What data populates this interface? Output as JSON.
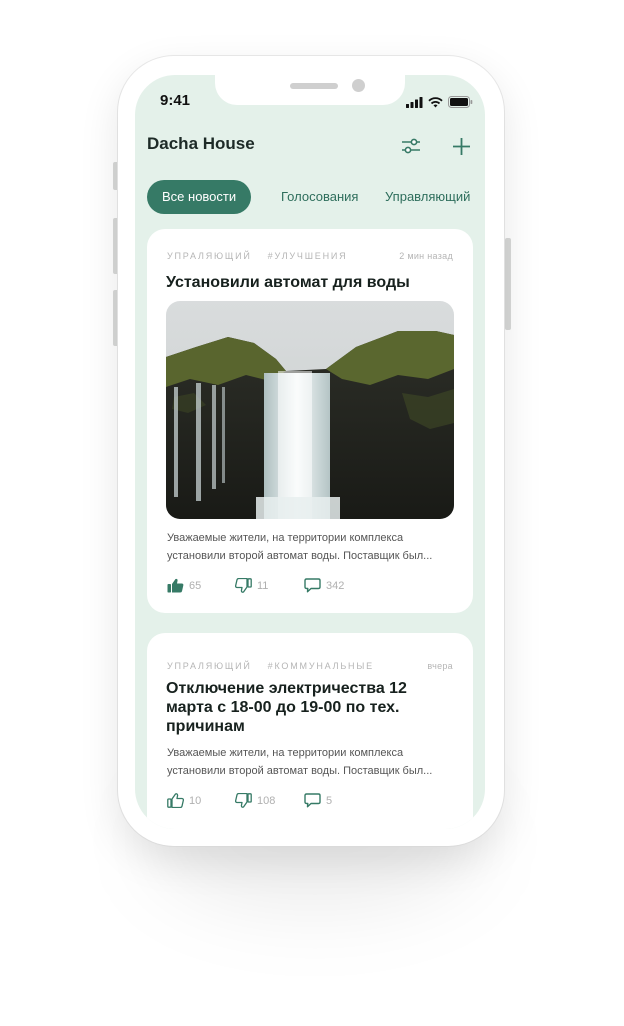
{
  "status_bar": {
    "time": "9:41"
  },
  "header": {
    "title": "Dacha House"
  },
  "tabs": [
    {
      "label": "Все новости",
      "active": true
    },
    {
      "label": "Голосования",
      "active": false
    },
    {
      "label": "Управляющий",
      "active": false
    }
  ],
  "posts": [
    {
      "author": "Упраляющий",
      "tag": "#улучшения",
      "time": "2 мин назад",
      "title": "Установили автомат для воды",
      "image": "waterfall",
      "description": "Уважаемые жители, на территории комплекса установили второй автомат воды. Поставщик был...",
      "likes": "65",
      "dislikes": "11",
      "comments": "342",
      "liked": true
    },
    {
      "author": "Упраляющий",
      "tag": "#коммунальные",
      "time": "вчера",
      "title": "Отключение электричества 12 марта с 18-00 до 19-00 по тех. причинам",
      "description": "Уважаемые жители, на территории комплекса установили второй автомат воды. Поставщик был...",
      "likes": "10",
      "dislikes": "108",
      "comments": "5",
      "liked": false
    }
  ],
  "colors": {
    "accent": "#367a66",
    "screen_bg": "#e4f1ea",
    "card_bg": "#ffffff"
  },
  "icons": [
    "filter-sliders-icon",
    "plus-icon",
    "thumbs-up-icon",
    "thumbs-down-icon",
    "comment-icon",
    "signal-icon",
    "wifi-icon",
    "battery-icon"
  ]
}
